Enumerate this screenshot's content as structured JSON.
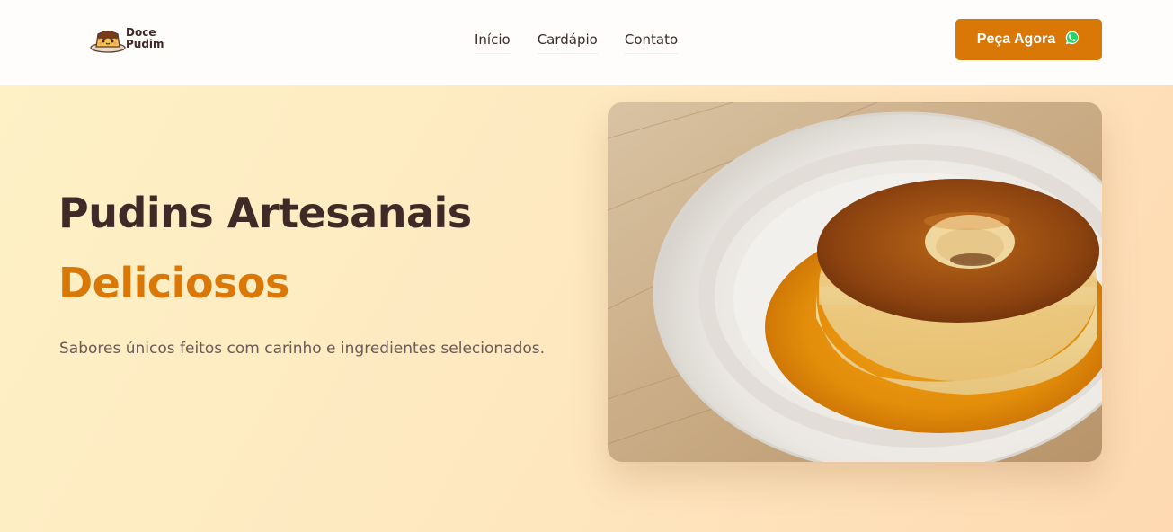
{
  "brand": {
    "line1": "Doce",
    "line2": "Pudim",
    "logo_icon": "pudding-face-icon"
  },
  "nav": {
    "items": [
      "Início",
      "Cardápio",
      "Contato"
    ]
  },
  "cta": {
    "label": "Peça Agora",
    "icon": "whatsapp-icon",
    "color": "#d97707"
  },
  "hero": {
    "title_line1": "Pudins Artesanais",
    "title_line2": "Deliciosos",
    "subtitle": "Sabores únicos feitos com carinho e ingredientes selecionados.",
    "image": "flan-on-white-plate-photo",
    "accent_color": "#d97707",
    "title_color": "#3f2a27"
  }
}
